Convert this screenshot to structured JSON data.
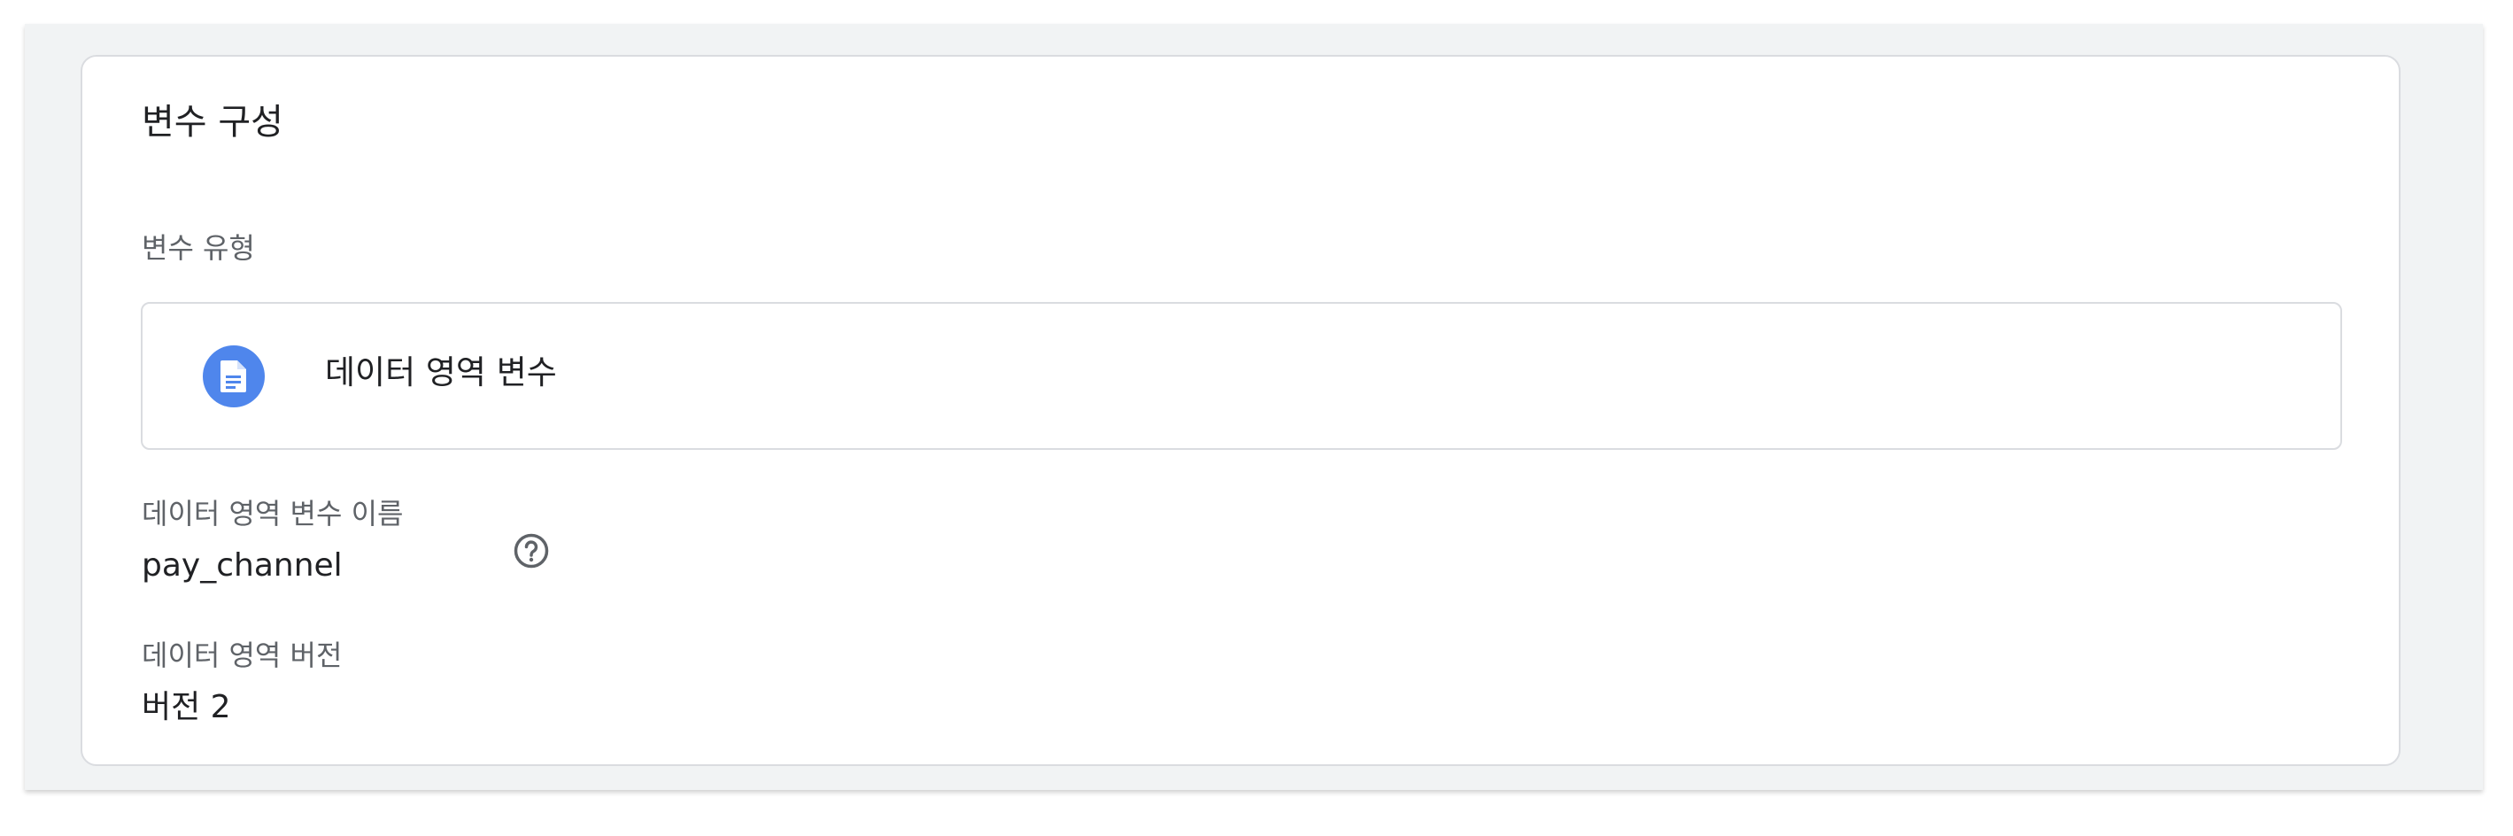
{
  "section": {
    "title": "변수 구성"
  },
  "variable_type": {
    "label": "변수 유형",
    "value": "데이터 영역 변수",
    "icon": "document-icon",
    "icon_color": "#4f86ec"
  },
  "variable_name": {
    "label": "데이터 영역 변수 이름",
    "value": "pay_channel",
    "help_icon": "help-circle-icon"
  },
  "data_layer_version": {
    "label": "데이터 영역 버전",
    "value": "버전 2"
  }
}
